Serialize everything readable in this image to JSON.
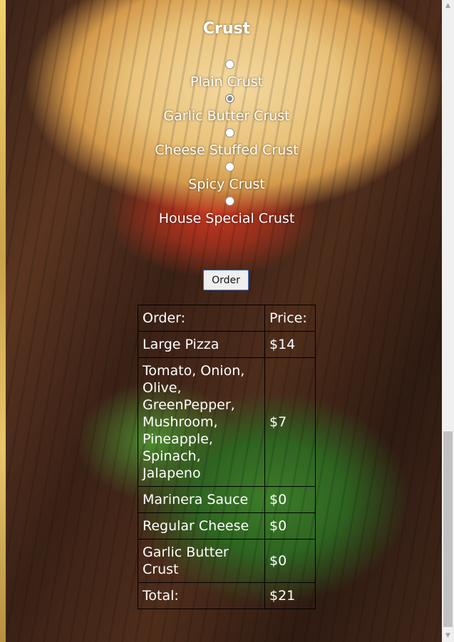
{
  "crust_section": {
    "heading": "Crust",
    "options": [
      {
        "label": "Plain Crust",
        "checked": false
      },
      {
        "label": "Garlic Butter Crust",
        "checked": true
      },
      {
        "label": "Cheese Stuffed Crust",
        "checked": false
      },
      {
        "label": "Spicy Crust",
        "checked": false
      },
      {
        "label": "House Special Crust",
        "checked": false
      }
    ]
  },
  "order_button": {
    "label": "Order"
  },
  "summary_table": {
    "headers": {
      "item": "Order:",
      "price": "Price:"
    },
    "rows": [
      {
        "item": "Large Pizza",
        "price": "$14"
      },
      {
        "item": "Tomato, Onion, Olive, GreenPepper, Mushroom, Pineapple, Spinach, Jalapeno",
        "price": "$7"
      },
      {
        "item": "Marinera Sauce",
        "price": "$0"
      },
      {
        "item": "Regular Cheese",
        "price": "$0"
      },
      {
        "item": "Garlic Butter Crust",
        "price": "$0"
      }
    ],
    "total": {
      "item": "Total:",
      "price": "$21"
    }
  },
  "colors": {
    "text": "#ffffff",
    "button_border": "#3b6fd1",
    "table_border": "#000000"
  }
}
